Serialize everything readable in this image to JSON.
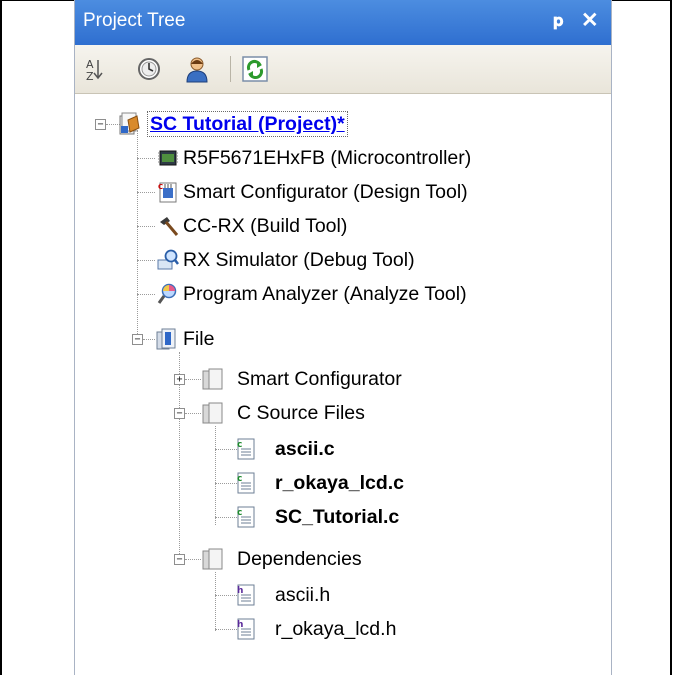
{
  "panel": {
    "title": "Project Tree",
    "pin_glyph": "p",
    "close_glyph": "✕"
  },
  "toolbar": {
    "icons": [
      "sort-az-icon",
      "clock-icon",
      "user-icon",
      "refresh-icon"
    ]
  },
  "tree": {
    "project": {
      "label": "SC Tutorial (Project)*",
      "icon": "project-icon",
      "expanded": true
    },
    "tools": [
      {
        "label": "R5F5671EHxFB (Microcontroller)",
        "icon": "chip-icon"
      },
      {
        "label": "Smart Configurator (Design Tool)",
        "icon": "smart-configurator-icon"
      },
      {
        "label": "CC-RX (Build Tool)",
        "icon": "hammer-icon"
      },
      {
        "label": "RX Simulator (Debug Tool)",
        "icon": "simulator-icon"
      },
      {
        "label": "Program Analyzer (Analyze Tool)",
        "icon": "analyzer-icon"
      }
    ],
    "file": {
      "label": "File",
      "icon": "folder-icon",
      "expanded": true
    },
    "folders": {
      "smart_configurator": {
        "label": "Smart Configurator",
        "expanded": false
      },
      "c_source": {
        "label": "C Source Files",
        "expanded": true
      },
      "dependencies": {
        "label": "Dependencies",
        "expanded": true
      }
    },
    "c_files": [
      {
        "label": "ascii.c"
      },
      {
        "label": "r_okaya_lcd.c"
      },
      {
        "label": "SC_Tutorial.c"
      }
    ],
    "h_files": [
      {
        "label": "ascii.h"
      },
      {
        "label": "r_okaya_lcd.h"
      }
    ]
  },
  "colors": {
    "title_bar": "#3a7bd8",
    "selected_link": "#0000ee",
    "toolbar_bg": "#efece4"
  }
}
